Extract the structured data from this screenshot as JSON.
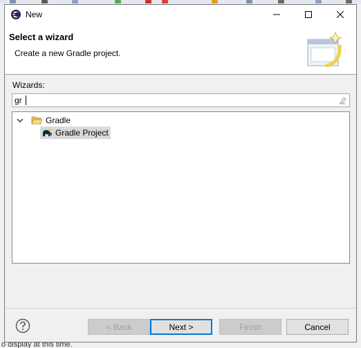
{
  "window": {
    "title": "New",
    "controls": [
      "minimize-icon",
      "maximize-icon",
      "close-icon"
    ]
  },
  "banner": {
    "title": "Select a wizard",
    "description": "Create a new Gradle project."
  },
  "filter": {
    "label": "Wizards:",
    "value": "gr"
  },
  "tree": {
    "items": [
      {
        "label": "Gradle",
        "icon": "folder-open-icon",
        "expanded": true
      },
      {
        "label": "Gradle Project",
        "icon": "gradle-elephant-icon",
        "selected": true
      }
    ]
  },
  "buttons": {
    "back": "< Back",
    "next": "Next >",
    "finish": "Finish",
    "cancel": "Cancel"
  },
  "background": {
    "status_text": "o display at this time."
  },
  "colors": {
    "selection": "#d9d9d9",
    "default_button_border": "#0078d7",
    "disabled_text": "#a0a0a0"
  }
}
